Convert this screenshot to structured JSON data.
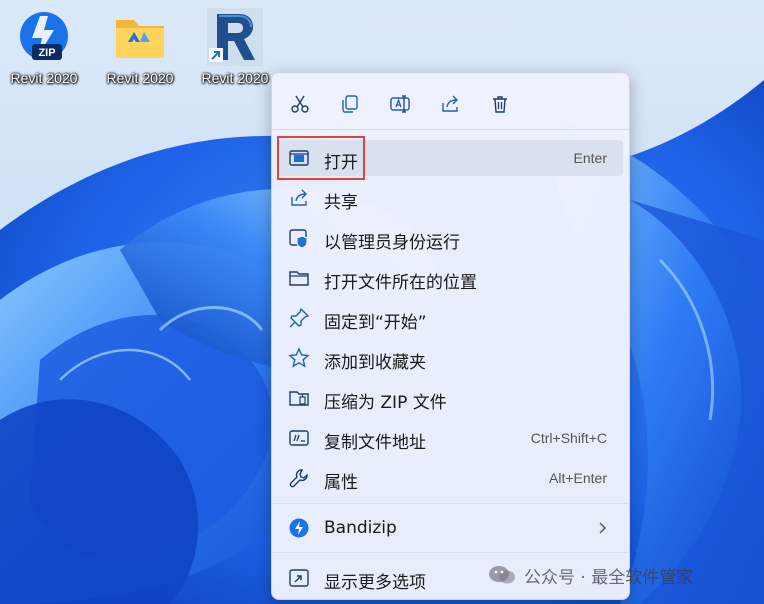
{
  "desktop": {
    "icons": [
      {
        "label": "Revit 2020",
        "icon": "zip-archive-icon"
      },
      {
        "label": "Revit 2020",
        "icon": "folder-icon"
      },
      {
        "label": "Revit 2020",
        "icon": "revit-shortcut-icon"
      }
    ]
  },
  "context_menu": {
    "quick_actions": [
      {
        "name": "cut",
        "icon": "scissors-icon"
      },
      {
        "name": "copy",
        "icon": "copy-icon"
      },
      {
        "name": "rename",
        "icon": "rename-icon"
      },
      {
        "name": "share",
        "icon": "share-icon"
      },
      {
        "name": "delete",
        "icon": "trash-icon"
      }
    ],
    "items": [
      {
        "label": "打开",
        "shortcut": "Enter",
        "icon": "open-window-icon"
      },
      {
        "label": "共享",
        "shortcut": "",
        "icon": "share-icon"
      },
      {
        "label": "以管理员身份运行",
        "shortcut": "",
        "icon": "shield-icon"
      },
      {
        "label": "打开文件所在的位置",
        "shortcut": "",
        "icon": "folder-icon"
      },
      {
        "label": "固定到“开始”",
        "shortcut": "",
        "icon": "pin-icon"
      },
      {
        "label": "添加到收藏夹",
        "shortcut": "",
        "icon": "star-icon"
      },
      {
        "label": "压缩为 ZIP 文件",
        "shortcut": "",
        "icon": "zip-folder-icon"
      },
      {
        "label": "复制文件地址",
        "shortcut": "Ctrl+Shift+C",
        "icon": "copy-path-icon"
      },
      {
        "label": "属性",
        "shortcut": "Alt+Enter",
        "icon": "wrench-icon"
      },
      {
        "label": "Bandizip",
        "shortcut": "",
        "icon": "bandizip-icon"
      },
      {
        "label": "显示更多选项",
        "shortcut": "",
        "icon": "more-options-icon"
      }
    ]
  },
  "watermark": {
    "text": "公众号 · 最全软件管家",
    "icon": "wechat-icon"
  },
  "colors": {
    "accent": "#0067c0",
    "highlight_box": "#e0423c",
    "menu_bg": "#eef2fc"
  }
}
